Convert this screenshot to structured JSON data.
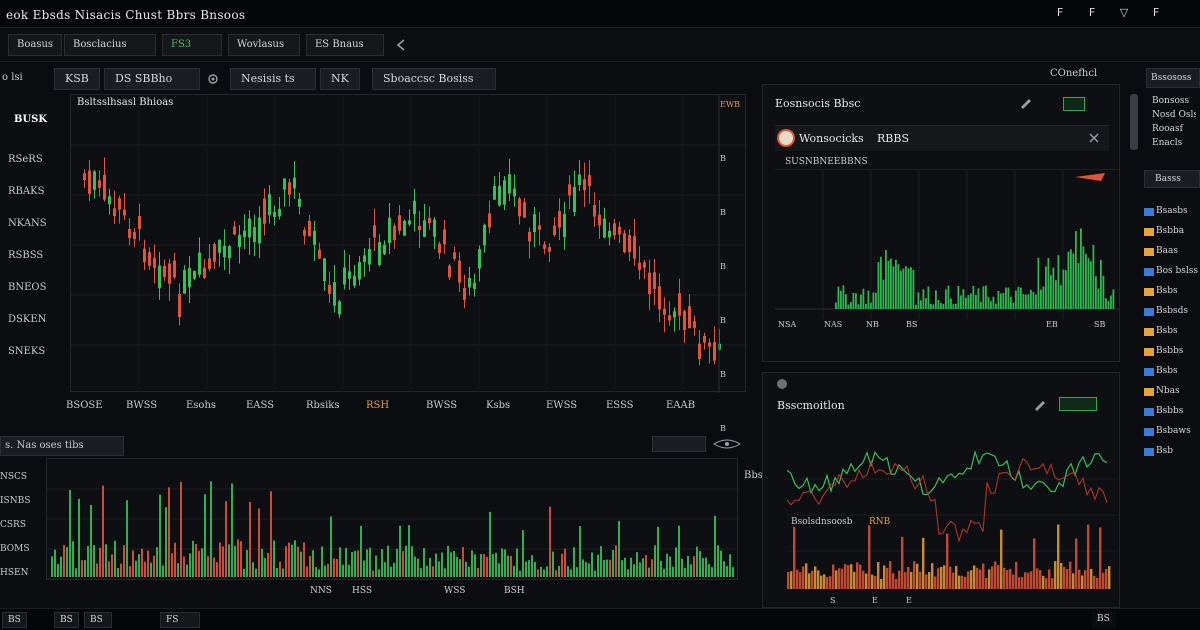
{
  "window": {
    "title": "eok Ebsds Nisacis Chust Bbrs  Bnsoos",
    "buttons": [
      "F",
      "F",
      "▽",
      "F"
    ]
  },
  "toolbar": {
    "items": [
      "Boasus",
      "Bosclacius",
      "FS3",
      "Wovlasus",
      "ES Bnaus"
    ],
    "back_icon": "back-arrow-icon"
  },
  "toolbar2": {
    "left_label": "o lsi",
    "chips": [
      "KSB",
      "DS SBBho",
      "Nesisis ts",
      "NK",
      "Sboaccsc Bosiss"
    ]
  },
  "main_chart": {
    "title": "Bsltsslhsasl Bhioas",
    "symbol": "BUSK",
    "y_labels": [
      "RSeRS",
      "RBAKS",
      "NKANS",
      "RSBSS",
      "BNEOS",
      "DSKEN",
      "SNEKS"
    ],
    "x_labels": [
      "BSOSE",
      "BWSS",
      "Esohs",
      "EASS",
      "Rbsiks",
      "RSH",
      "BWSS",
      "Ksbs",
      "EWSS",
      "ESSS",
      "EAAB"
    ],
    "right_labels": [
      "EWB",
      "B",
      "B",
      "B",
      "B",
      "B",
      "B"
    ],
    "colors": {
      "up": "#35c05a",
      "down": "#e0543a"
    }
  },
  "volume_panel": {
    "tab_label": "s.    Nas oses tibs",
    "y_labels": [
      "NSCS",
      "ISNBS",
      "CSRS",
      "BOMS",
      "HSEN"
    ],
    "x_labels": [
      "NNS",
      "HSS",
      "WSS",
      "BSH"
    ],
    "right_label": "Bbsais"
  },
  "side_panel_top": {
    "header": "COnefhcl",
    "title": "Eosnsocis Bbsc",
    "subtitle": "Wonsocicks",
    "ticker": "RBBS",
    "sublabel": "SUSNBNEEBBNS",
    "x_labels": [
      "NSA",
      "NAS",
      "NB",
      "BS",
      "EB",
      "SB"
    ]
  },
  "side_panel_bottom": {
    "title": "Bsscmoitlon",
    "sublabel": "Bsolsdnsoosb",
    "highlight": "RNB",
    "x_labels": [
      "S",
      "E",
      "E"
    ]
  },
  "right_sidebar": {
    "top_button": "Bssososs",
    "header_lines": [
      "Bonsoss",
      "Nosd Oslss",
      "Rooasf",
      "Enacls"
    ],
    "tab": "Basss",
    "items": [
      "Bsasbs",
      "Bsbba",
      "Baas",
      "Bos bslss",
      "Bsbs",
      "Bsbsds",
      "Bsbs",
      "Bsbbs",
      "Bsbs",
      "Nbas",
      "Bsbbs",
      "Bsbaws",
      "Bsb"
    ]
  },
  "statusbar": {
    "items": [
      "BS",
      "BS",
      "BS",
      "FS",
      "BS"
    ]
  }
}
